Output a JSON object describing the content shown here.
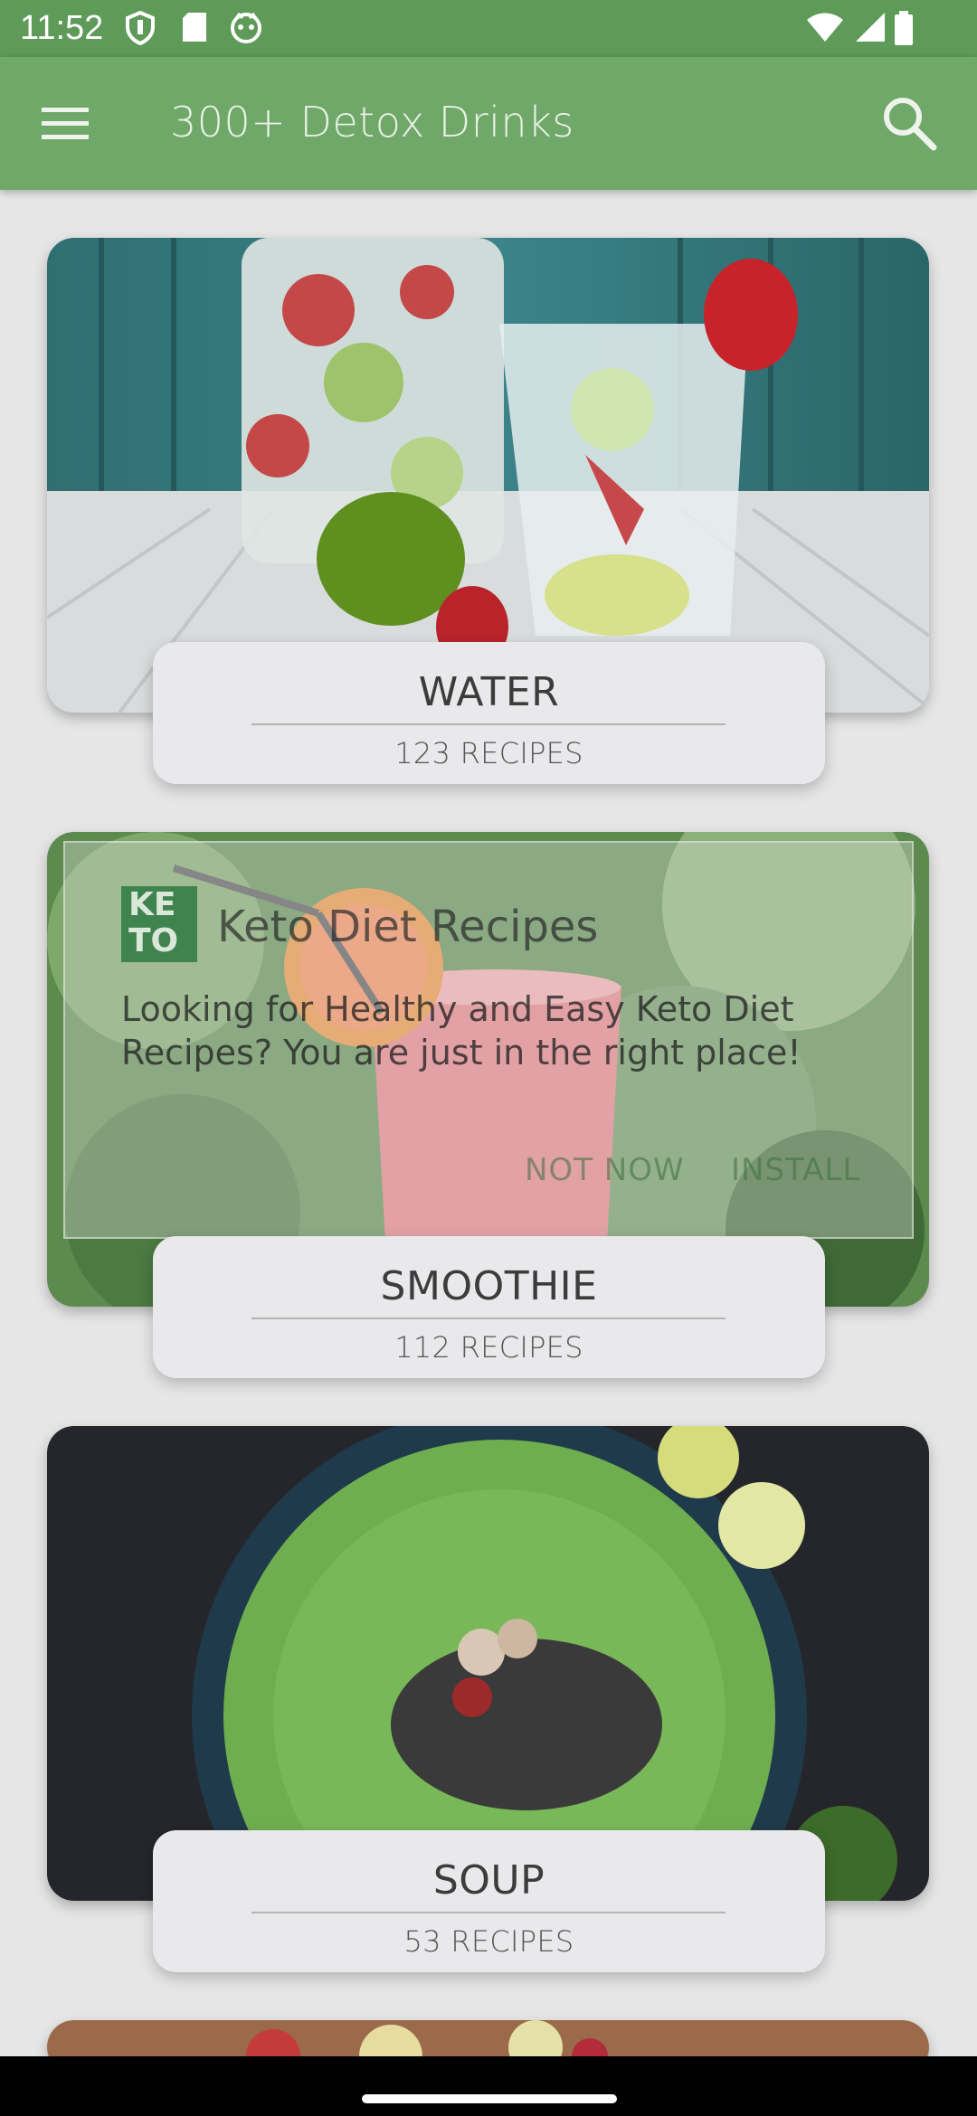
{
  "status_bar": {
    "time": "11:52",
    "left_icons": [
      "shield-icon",
      "sd-card-icon",
      "face-icon"
    ],
    "right_icons": [
      "wifi-icon",
      "signal-icon",
      "battery-icon"
    ]
  },
  "app_bar": {
    "title": "300+ Detox Drinks",
    "menu_icon": "menu-icon",
    "search_icon": "search-icon",
    "color": "#6fa868"
  },
  "categories": [
    {
      "name": "WATER",
      "count": "123 RECIPES"
    },
    {
      "name": "SMOOTHIE",
      "count": "112 RECIPES"
    },
    {
      "name": "SOUP",
      "count": "53 RECIPES"
    }
  ],
  "ad": {
    "logo_text_top": "KE",
    "logo_text_bottom": "TO",
    "title": "Keto Diet Recipes",
    "description": "Looking for Healthy and Easy Keto Diet Recipes? You are just in the right place!",
    "dismiss_label": "NOT NOW",
    "install_label": "INSTALL"
  }
}
